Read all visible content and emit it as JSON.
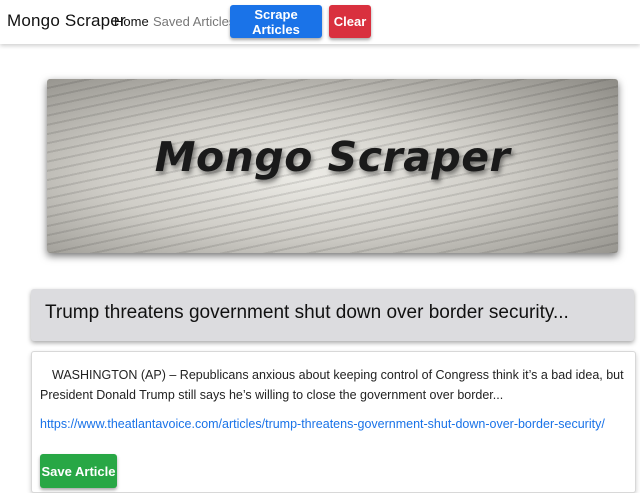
{
  "navbar": {
    "brand": "Mongo Scraper",
    "links": [
      {
        "label": "Home"
      },
      {
        "label": "Saved Articles"
      }
    ],
    "scrape_button": "Scrape Articles",
    "clear_button": "Clear",
    "colors": {
      "scrape": "#1a73e8",
      "clear": "#d9303e"
    }
  },
  "jumbotron": {
    "title": "Mongo Scraper"
  },
  "article": {
    "title": "Trump threatens government shut down over border security...",
    "summary": "WASHINGTON (AP) – Republicans anxious about keeping control of Congress think it’s a bad idea, but President Donald Trump still says he’s willing to close the government over border...",
    "link": "https://www.theatlantavoice.com/articles/trump-threatens-government-shut-down-over-border-security/",
    "save_button": "Save Article",
    "save_color": "#28a745"
  }
}
